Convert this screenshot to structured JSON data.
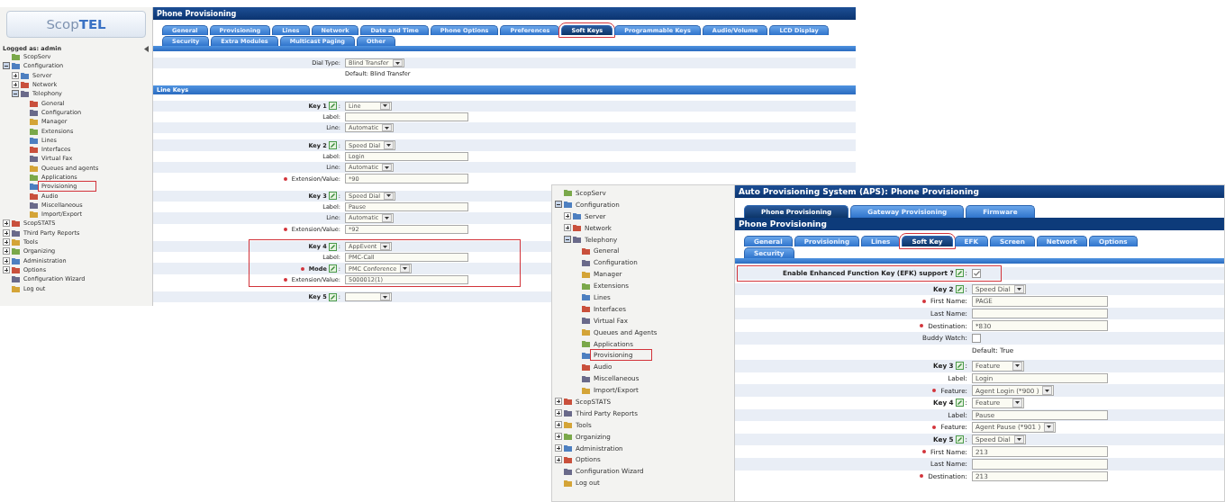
{
  "screenshots": [
    {
      "sidebar": {
        "logo": "Scop**TEL**",
        "user": "Logged as: admin",
        "tree": [
          {
            "label": "ScopServ",
            "highlighted": false
          },
          {
            "label": "Configuration",
            "expanded": true,
            "highlighted": false,
            "children": [
              {
                "label": "Server",
                "expanded": false,
                "highlighted": false
              },
              {
                "label": "Network",
                "expanded": false,
                "highlighted": false
              },
              {
                "label": "Telephony",
                "expanded": true,
                "highlighted": false,
                "children": [
                  {
                    "label": "General",
                    "highlighted": false
                  },
                  {
                    "label": "Configuration",
                    "highlighted": false
                  },
                  {
                    "label": "Manager",
                    "highlighted": false
                  },
                  {
                    "label": "Extensions",
                    "highlighted": false
                  },
                  {
                    "label": "Lines",
                    "highlighted": false
                  },
                  {
                    "label": "Interfaces",
                    "highlighted": false
                  },
                  {
                    "label": "Virtual Fax",
                    "highlighted": false
                  },
                  {
                    "label": "Queues and agents",
                    "highlighted": false
                  },
                  {
                    "label": "Applications",
                    "highlighted": false
                  },
                  {
                    "label": "Provisioning",
                    "highlighted": true
                  },
                  {
                    "label": "Audio",
                    "highlighted": false
                  },
                  {
                    "label": "Miscellaneous",
                    "highlighted": false
                  },
                  {
                    "label": "Import/Export",
                    "highlighted": false
                  }
                ]
              }
            ]
          },
          {
            "label": "ScopSTATS",
            "expanded": false,
            "highlighted": false
          },
          {
            "label": "Third Party Reports",
            "expanded": false,
            "highlighted": false
          },
          {
            "label": "Tools",
            "expanded": false,
            "highlighted": false
          },
          {
            "label": "Organizing",
            "expanded": false,
            "highlighted": false
          },
          {
            "label": "Administration",
            "expanded": false,
            "highlighted": false
          },
          {
            "label": "Options",
            "expanded": false,
            "highlighted": false
          },
          {
            "label": "Configuration Wizard",
            "highlighted": false
          },
          {
            "label": "Log out",
            "highlighted": false
          }
        ]
      },
      "main": {
        "title": "Phone Provisioning",
        "tab_rows": [
          [
            {
              "label": "General",
              "selected": false,
              "highlighted": false
            },
            {
              "label": "Provisioning",
              "selected": false,
              "highlighted": false
            },
            {
              "label": "Lines",
              "selected": false,
              "highlighted": false
            },
            {
              "label": "Network",
              "selected": false,
              "highlighted": false
            },
            {
              "label": "Date and Time",
              "selected": false,
              "highlighted": false
            },
            {
              "label": "Phone Options",
              "selected": false,
              "highlighted": false
            },
            {
              "label": "Preferences",
              "selected": false,
              "highlighted": false
            },
            {
              "label": "Soft Keys",
              "selected": true,
              "highlighted": true
            },
            {
              "label": "Programmable Keys",
              "selected": false,
              "highlighted": false
            },
            {
              "label": "Audio/Volume",
              "selected": false,
              "highlighted": false
            },
            {
              "label": "LCD Display",
              "selected": false,
              "highlighted": false
            }
          ],
          [
            {
              "label": "Security",
              "selected": false,
              "highlighted": false
            },
            {
              "label": "Extra Modules",
              "selected": false,
              "highlighted": false
            },
            {
              "label": "Multicast Paging",
              "selected": false,
              "highlighted": false
            },
            {
              "label": "Other",
              "selected": false,
              "highlighted": false
            }
          ]
        ],
        "sections": [
          {
            "groups": [
              {
                "highlighted": false,
                "rows": [
                  {
                    "label": "Dial Type:",
                    "kind": "select",
                    "value": "Blind Transfer"
                  },
                  {
                    "kind": "note",
                    "text": "Default: Blind Transfer"
                  }
                ]
              }
            ]
          },
          {
            "header": "Line Keys",
            "groups": [
              {
                "highlighted": false,
                "rows": [
                  {
                    "label": "Key 1",
                    "edit_icon": true,
                    "suffix": ":",
                    "kind": "select",
                    "value": "Line"
                  },
                  {
                    "label": "Label:",
                    "kind": "text"
                  },
                  {
                    "label": "Line:",
                    "kind": "select",
                    "value": "Automatic"
                  }
                ]
              },
              {
                "highlighted": false,
                "rows": [
                  {
                    "label": "Key 2",
                    "edit_icon": true,
                    "suffix": ":",
                    "kind": "select",
                    "value": "Speed Dial"
                  },
                  {
                    "label": "Label:",
                    "kind": "text",
                    "value": "Login"
                  },
                  {
                    "label": "Line:",
                    "kind": "select",
                    "value": "Automatic"
                  },
                  {
                    "label": "Extension/Value:",
                    "required": true,
                    "kind": "text",
                    "value": "*90"
                  }
                ]
              },
              {
                "highlighted": false,
                "rows": [
                  {
                    "label": "Key 3",
                    "edit_icon": true,
                    "suffix": ":",
                    "kind": "select",
                    "value": "Speed Dial"
                  },
                  {
                    "label": "Label:",
                    "kind": "text",
                    "value": "Pause"
                  },
                  {
                    "label": "Line:",
                    "kind": "select",
                    "value": "Automatic"
                  },
                  {
                    "label": "Extension/Value:",
                    "required": true,
                    "kind": "text",
                    "value": "*92"
                  }
                ]
              },
              {
                "highlighted": true,
                "rows": [
                  {
                    "label": "Key 4",
                    "edit_icon": true,
                    "suffix": ":",
                    "kind": "select",
                    "value": "AppEvent"
                  },
                  {
                    "label": "Label:",
                    "kind": "text",
                    "value": "PMC-Call"
                  },
                  {
                    "label": "Mode",
                    "required": true,
                    "edit_icon": true,
                    "suffix": ":",
                    "kind": "select",
                    "value": "PMC Conference"
                  },
                  {
                    "label": "Extension/Value:",
                    "required": true,
                    "kind": "text",
                    "value": "5000012(1)"
                  }
                ]
              },
              {
                "highlighted": false,
                "rows": [
                  {
                    "label": "Key 5",
                    "edit_icon": true,
                    "suffix": ":",
                    "kind": "select"
                  }
                ]
              }
            ]
          }
        ]
      }
    },
    {
      "sidebar": {
        "tree": [
          {
            "label": "ScopServ",
            "highlighted": false
          },
          {
            "label": "Configuration",
            "expanded": true,
            "highlighted": false,
            "children": [
              {
                "label": "Server",
                "expanded": false,
                "highlighted": false
              },
              {
                "label": "Network",
                "expanded": false,
                "highlighted": false
              },
              {
                "label": "Telephony",
                "expanded": true,
                "highlighted": false,
                "children": [
                  {
                    "label": "General",
                    "highlighted": false
                  },
                  {
                    "label": "Configuration",
                    "highlighted": false
                  },
                  {
                    "label": "Manager",
                    "highlighted": false
                  },
                  {
                    "label": "Extensions",
                    "highlighted": false
                  },
                  {
                    "label": "Lines",
                    "highlighted": false
                  },
                  {
                    "label": "Interfaces",
                    "highlighted": false
                  },
                  {
                    "label": "Virtual Fax",
                    "highlighted": false
                  },
                  {
                    "label": "Queues and Agents",
                    "highlighted": false
                  },
                  {
                    "label": "Applications",
                    "highlighted": false
                  },
                  {
                    "label": "Provisioning",
                    "highlighted": true
                  },
                  {
                    "label": "Audio",
                    "highlighted": false
                  },
                  {
                    "label": "Miscellaneous",
                    "highlighted": false
                  },
                  {
                    "label": "Import/Export",
                    "highlighted": false
                  }
                ]
              }
            ]
          },
          {
            "label": "ScopSTATS",
            "expanded": false,
            "highlighted": false
          },
          {
            "label": "Third Party Reports",
            "expanded": false,
            "highlighted": false
          },
          {
            "label": "Tools",
            "expanded": false,
            "highlighted": false
          },
          {
            "label": "Organizing",
            "expanded": false,
            "highlighted": false
          },
          {
            "label": "Administration",
            "expanded": false,
            "highlighted": false
          },
          {
            "label": "Options",
            "expanded": false,
            "highlighted": false
          },
          {
            "label": "Configuration Wizard",
            "highlighted": false
          },
          {
            "label": "Log out",
            "highlighted": false
          }
        ]
      },
      "main": {
        "title": "Auto Provisioning System (APS):  Phone Provisioning",
        "top_tabs": [
          {
            "label": "Phone Provisioning",
            "selected": true
          },
          {
            "label": "Gateway Provisioning",
            "selected": false
          },
          {
            "label": "Firmware",
            "selected": false
          }
        ],
        "subtitle": "Phone Provisioning",
        "tab_rows": [
          [
            {
              "label": "General",
              "selected": false,
              "highlighted": false
            },
            {
              "label": "Provisioning",
              "selected": false,
              "highlighted": false
            },
            {
              "label": "Lines",
              "selected": false,
              "highlighted": false
            },
            {
              "label": "Soft Key",
              "selected": true,
              "highlighted": true
            },
            {
              "label": "EFK",
              "selected": false,
              "highlighted": false
            },
            {
              "label": "Screen",
              "selected": false,
              "highlighted": false
            },
            {
              "label": "Network",
              "selected": false,
              "highlighted": false
            },
            {
              "label": "Options",
              "selected": false,
              "highlighted": false
            }
          ],
          [
            {
              "label": "Security",
              "selected": false,
              "highlighted": false
            }
          ]
        ],
        "sections": [
          {
            "groups": [
              {
                "highlighted": true,
                "rows": [
                  {
                    "label": "Enable Enhanced Function Key (EFK) support ?",
                    "edit_icon": true,
                    "suffix": ":",
                    "kind": "checkbox",
                    "checked": true
                  }
                ]
              },
              {
                "highlighted": false,
                "rows": [
                  {
                    "label": "Key 2",
                    "edit_icon": true,
                    "suffix": ":",
                    "kind": "select",
                    "value": "Speed Dial"
                  },
                  {
                    "label": "First Name:",
                    "required": true,
                    "kind": "text",
                    "value": "PAGE"
                  },
                  {
                    "label": "Last Name:",
                    "kind": "text"
                  },
                  {
                    "label": "Destination:",
                    "required": true,
                    "kind": "text",
                    "value": "*830"
                  },
                  {
                    "label": "Buddy Watch:",
                    "kind": "checkbox",
                    "checked": false
                  },
                  {
                    "kind": "note",
                    "text": "Default: True"
                  }
                ]
              },
              {
                "highlighted": false,
                "rows": [
                  {
                    "label": "Key 3",
                    "edit_icon": true,
                    "suffix": ":",
                    "kind": "select",
                    "value": "Feature"
                  },
                  {
                    "label": "Label:",
                    "kind": "text",
                    "value": "Login"
                  },
                  {
                    "label": "Feature:",
                    "required": true,
                    "kind": "select",
                    "value": "Agent Login (*900 )"
                  },
                  {
                    "label": "Key 4",
                    "edit_icon": true,
                    "suffix": ":",
                    "kind": "select",
                    "value": "Feature"
                  },
                  {
                    "label": "Label:",
                    "kind": "text",
                    "value": "Pause"
                  },
                  {
                    "label": "Feature:",
                    "required": true,
                    "kind": "select",
                    "value": "Agent Pause (*901 )"
                  },
                  {
                    "label": "Key 5",
                    "edit_icon": true,
                    "suffix": ":",
                    "kind": "select",
                    "value": "Speed Dial"
                  },
                  {
                    "label": "First Name:",
                    "required": true,
                    "kind": "text",
                    "value": "213"
                  },
                  {
                    "label": "Last Name:",
                    "kind": "text"
                  },
                  {
                    "label": "Destination:",
                    "required": true,
                    "kind": "text",
                    "value": "213"
                  }
                ]
              }
            ]
          }
        ]
      }
    }
  ]
}
